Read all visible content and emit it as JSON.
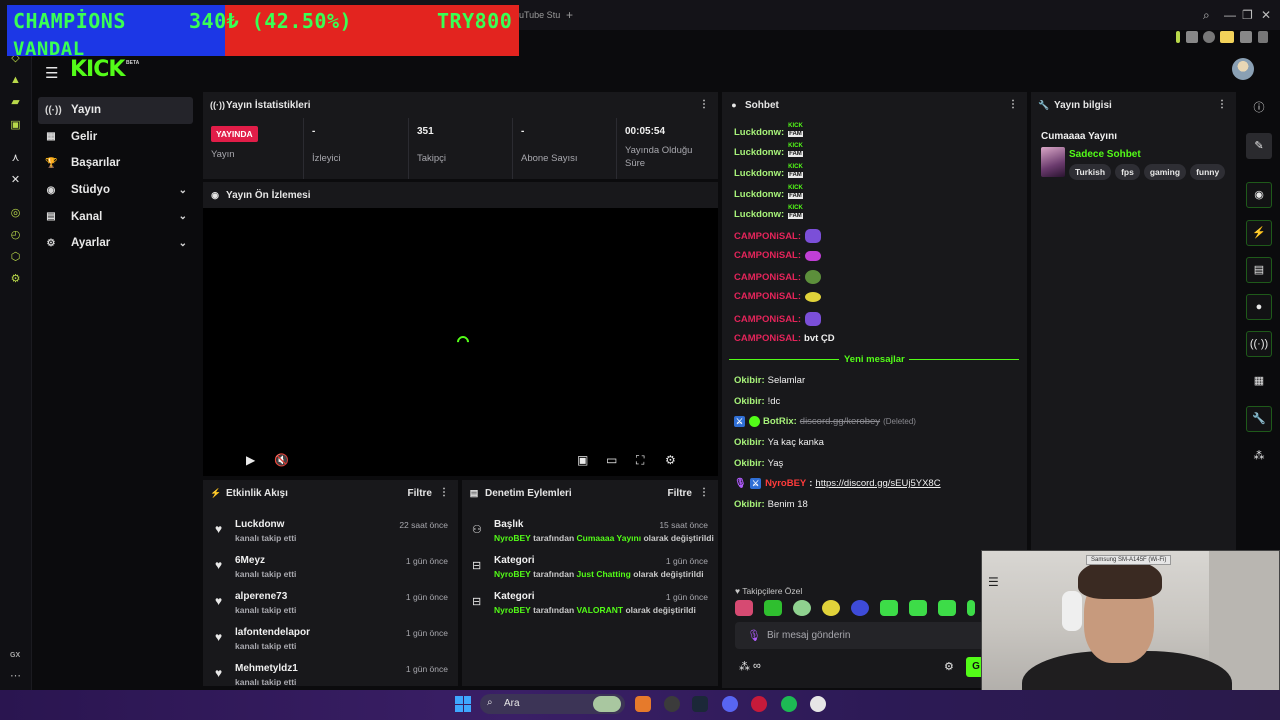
{
  "browser": {
    "tab_label": "uTube Stu",
    "tab_plus": "+",
    "win_controls": [
      "⌕",
      "—",
      "❐",
      "✕"
    ],
    "gx_label": "GX"
  },
  "overlay": {
    "line1": "CHAMPİONS",
    "line2": "VANDAL",
    "price": "340₺ (42.50%)",
    "goal": "TRY800"
  },
  "header": {
    "menu_icon": "☰",
    "logo": "KICK",
    "logo_badge": "BETA"
  },
  "nav": {
    "items": [
      {
        "label": "Yayın",
        "icon": "((·))",
        "active": true,
        "chevron": ""
      },
      {
        "label": "Gelir",
        "icon": "▦",
        "active": false,
        "chevron": ""
      },
      {
        "label": "Başarılar",
        "icon": "🏆",
        "active": false,
        "chevron": ""
      },
      {
        "label": "Stüdyo",
        "icon": "◉",
        "active": false,
        "chevron": "⌄"
      },
      {
        "label": "Kanal",
        "icon": "▤",
        "active": false,
        "chevron": "⌄"
      },
      {
        "label": "Ayarlar",
        "icon": "⚙",
        "active": false,
        "chevron": "⌄"
      }
    ]
  },
  "stats_panel": {
    "title": "Yayın İstatistikleri",
    "live_badge": "YAYINDA",
    "items": [
      {
        "value": "",
        "label": "Yayın"
      },
      {
        "value": "-",
        "label": "İzleyici"
      },
      {
        "value": "351",
        "label": "Takipçi"
      },
      {
        "value": "-",
        "label": "Abone Sayısı"
      },
      {
        "value": "00:05:54",
        "label": "Yayında Olduğu Süre"
      }
    ]
  },
  "preview_panel": {
    "title": "Yayın Ön İzlemesi"
  },
  "activity_panel": {
    "title": "Etkinlik Akışı",
    "filter": "Filtre",
    "rows": [
      {
        "name": "Luckdonw",
        "sub": "kanalı takip etti",
        "time": "22 saat önce"
      },
      {
        "name": "6Meyz",
        "sub": "kanalı takip etti",
        "time": "1 gün önce"
      },
      {
        "name": "alperene73",
        "sub": "kanalı takip etti",
        "time": "1 gün önce"
      },
      {
        "name": "lafontendelapor",
        "sub": "kanalı takip etti",
        "time": "1 gün önce"
      },
      {
        "name": "Mehmetyldz1",
        "sub": "kanalı takip etti",
        "time": "1 gün önce"
      }
    ]
  },
  "moderation_panel": {
    "title": "Denetim Eylemleri",
    "filter": "Filtre",
    "rows": [
      {
        "name": "Başlık",
        "user": "NyroBEY",
        "mid": " tarafından ",
        "value": "Cumaaaa Yayını",
        "end": " olarak değiştirildi",
        "time": "15 saat önce"
      },
      {
        "name": "Kategori",
        "user": "NyroBEY",
        "mid": " tarafından ",
        "value": "Just Chatting",
        "end": " olarak değiştirildi",
        "time": "1 gün önce"
      },
      {
        "name": "Kategori",
        "user": "NyroBEY",
        "mid": " tarafından ",
        "value": "VALORANT",
        "end": " olarak değiştirildi",
        "time": "1 gün önce"
      }
    ]
  },
  "chat_panel": {
    "title": "Sohbet",
    "kick_k": "KICK",
    "kick_f": "FAM",
    "user_luck": "Luckdonw:",
    "user_camp": "CAMPONiSAL:",
    "camp_last_text": "bvt ÇD",
    "new_messages": "Yeni mesajlar",
    "lines": [
      {
        "user": "Okibir:",
        "text": "Selamlar"
      },
      {
        "user": "Okibir:",
        "text": "!dc"
      },
      {
        "user": "Okibir:",
        "text": "Ya kaç kanka"
      },
      {
        "user": "Okibir:",
        "text": "Yaş"
      },
      {
        "user": "Okibir:",
        "text": "Benim 18"
      }
    ],
    "botrix_user": "BotRix:",
    "botrix_text": "discord.gg/kerobey",
    "botrix_deleted": "(Deleted)",
    "nyro_user": "NyroBEY",
    "nyro_link": "https://discord.gg/sEUj5YX8C",
    "sub_emotes": "Takipçilere Özel",
    "input_placeholder": "Bir mesaj gönderin",
    "send": "G"
  },
  "info_panel": {
    "title": "Yayın bilgisi",
    "stream_title": "Cumaaaa Yayını",
    "category": "Sadece Sohbet",
    "tags": [
      "Turkish",
      "fps",
      "gaming",
      "funny"
    ]
  },
  "webcam": {
    "label": "Samsung SM-A145F (Wi-Fi)"
  },
  "taskbar": {
    "search": "Ara"
  },
  "colors": {
    "accent": "#53fc18",
    "live": "#e11d48",
    "banner_blue": "#1c37e6",
    "banner_red": "#e3241f",
    "banner_text": "#39ff54"
  }
}
